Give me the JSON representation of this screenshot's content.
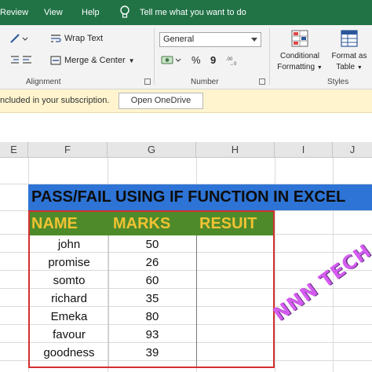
{
  "menu": {
    "items": [
      "Review",
      "View",
      "Help"
    ],
    "tell_me": "Tell me what you want to do"
  },
  "ribbon": {
    "wrap_text": "Wrap Text",
    "merge_center": "Merge & Center",
    "alignment_label": "Alignment",
    "number_format_value": "General",
    "percent_symbol": "%",
    "comma_symbol": "9",
    "number_label": "Number",
    "conditional_formatting_line1": "Conditional",
    "conditional_formatting_line2": "Formatting",
    "format_as_table_line1": "Format as",
    "format_as_table_line2": "Table",
    "styles_label": "Styles"
  },
  "infobar": {
    "message": "ncluded in your subscription.",
    "button": "Open OneDrive"
  },
  "columns": [
    "E",
    "F",
    "G",
    "H",
    "I",
    "J"
  ],
  "sheet": {
    "title": "PASS/FAIL  USING IF FUNCTION IN EXCEL",
    "headers": {
      "name": "NAME",
      "marks": "MARKS",
      "result": "RESUIT"
    },
    "rows": [
      {
        "name": "john",
        "marks": "50"
      },
      {
        "name": "promise",
        "marks": "26"
      },
      {
        "name": "somto",
        "marks": "60"
      },
      {
        "name": "richard",
        "marks": "35"
      },
      {
        "name": "Emeka",
        "marks": "80"
      },
      {
        "name": "favour",
        "marks": "93"
      },
      {
        "name": "goodness",
        "marks": "39"
      }
    ]
  },
  "watermark": "NNN TECH",
  "colors": {
    "excel_green": "#217346",
    "banner_blue": "#2e74d6",
    "header_green": "#4f8a2a",
    "header_text": "#f1c232",
    "table_border": "#d43030",
    "info_yellow": "#fff4ce"
  }
}
